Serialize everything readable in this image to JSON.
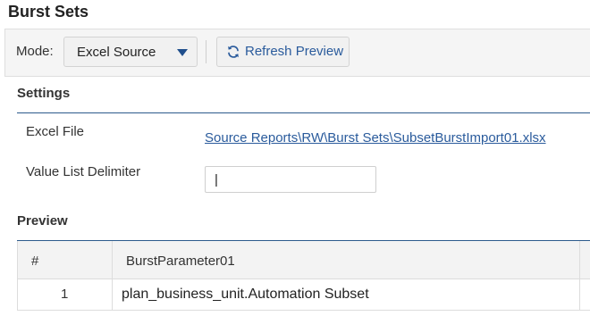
{
  "page": {
    "title": "Burst Sets"
  },
  "toolbar": {
    "mode_label": "Mode:",
    "mode_value": "Excel Source",
    "refresh_label": "Refresh Preview",
    "refresh_icon": "refresh-icon",
    "caret_icon": "chevron-down-icon"
  },
  "settings": {
    "heading": "Settings",
    "excel_file_label": "Excel File",
    "excel_file_value": "Source Reports\\RW\\Burst Sets\\SubsetBurstImport01.xlsx",
    "delimiter_label": "Value List Delimiter",
    "delimiter_value": "|"
  },
  "preview": {
    "heading": "Preview",
    "columns": [
      "#",
      "BurstParameter01"
    ],
    "rows": [
      {
        "num": "1",
        "value": "plan_business_unit.Automation Subset"
      }
    ]
  },
  "colors": {
    "accent": "#2a5b9c",
    "caret": "#1f4e8c",
    "section_line": "#2c5a8c"
  }
}
